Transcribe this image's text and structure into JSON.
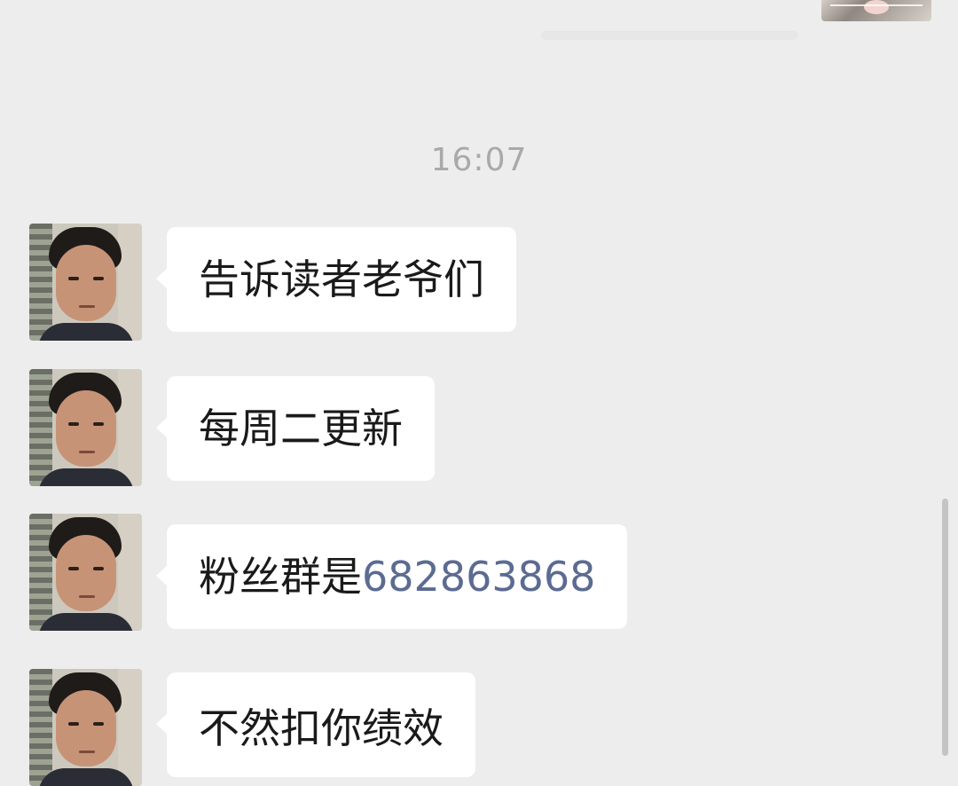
{
  "chat": {
    "timestamp": "16:07",
    "messages": [
      {
        "text": "告诉读者老爷们"
      },
      {
        "text": "每周二更新"
      },
      {
        "prefix": "粉丝群是",
        "link": "682863868"
      },
      {
        "text": "不然扣你绩效"
      }
    ]
  },
  "colors": {
    "background": "#ededed",
    "bubble": "#ffffff",
    "timestamp": "#a9a9a9",
    "link": "#5b6b92"
  }
}
